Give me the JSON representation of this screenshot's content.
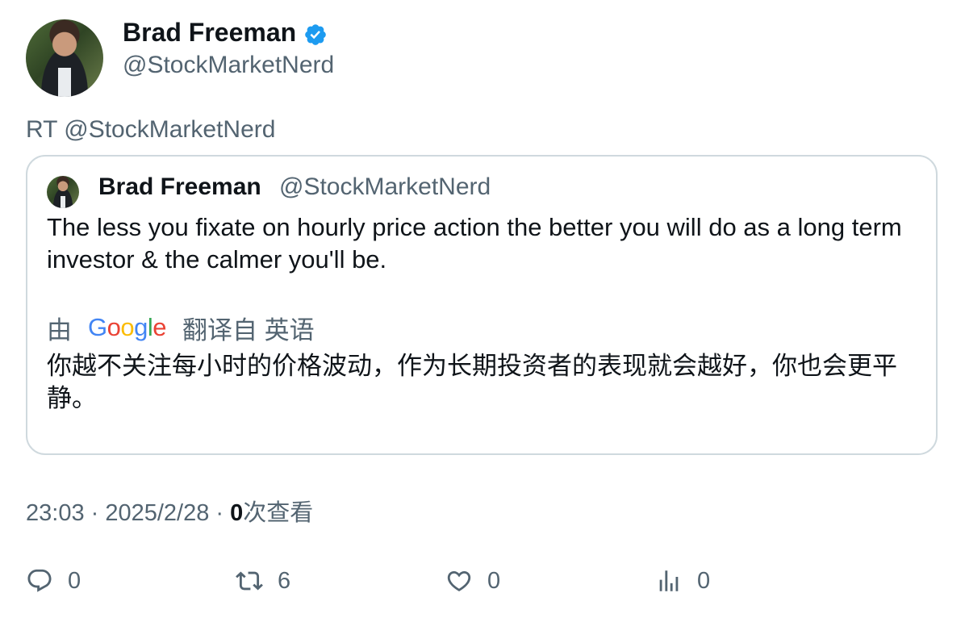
{
  "author": {
    "name": "Brad Freeman",
    "handle": "@StockMarketNerd",
    "verified": true
  },
  "retweet_line": "RT @StockMarketNerd",
  "quoted": {
    "name": "Brad Freeman",
    "handle": "@StockMarketNerd",
    "text": "The less you fixate on hourly price action the better you will do as a long term investor & the calmer you'll be.",
    "translation": {
      "prefix": "由",
      "provider_logo": "Google",
      "suffix": "翻译自 英语",
      "text": "你越不关注每小时的价格波动，作为长期投资者的表现就会越好，你也会更平静。"
    }
  },
  "meta": {
    "time": "23:03",
    "separator": " · ",
    "date": "2025/2/28",
    "views_count": "0",
    "views_label": "次查看"
  },
  "actions": [
    {
      "icon": "reply-icon",
      "count": "0"
    },
    {
      "icon": "retweet-icon",
      "count": "6"
    },
    {
      "icon": "like-icon",
      "count": "0"
    },
    {
      "icon": "views-icon",
      "count": "0"
    }
  ],
  "colors": {
    "text_primary": "#0f1419",
    "text_secondary": "#536471",
    "verified_blue": "#1d9bf0",
    "border": "#cfd9de"
  }
}
